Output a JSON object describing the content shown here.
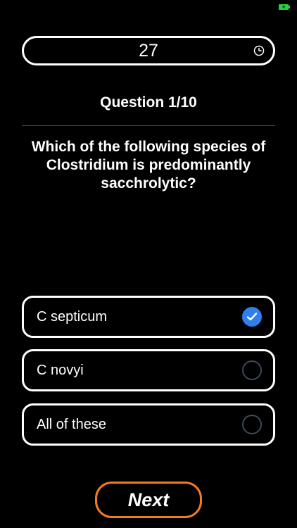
{
  "timer": {
    "value": "27",
    "icon": "clock-icon"
  },
  "question": {
    "counter": "Question 1/10",
    "text": "Which of the following species of Clostridium is predominantly sacchrolytic?"
  },
  "options": [
    {
      "label": "C septicum",
      "selected": true
    },
    {
      "label": "C novyi",
      "selected": false
    },
    {
      "label": "All of these",
      "selected": false
    }
  ],
  "next_button": {
    "label": "Next"
  },
  "colors": {
    "background": "#000000",
    "text": "#ffffff",
    "selected": "#2f80ed",
    "unselected_ring": "#3b4a5c",
    "next_border": "#f27c22",
    "battery": "#2ecc40"
  }
}
